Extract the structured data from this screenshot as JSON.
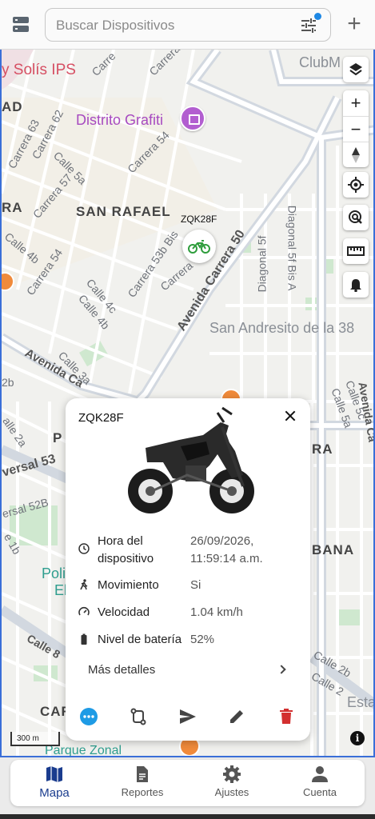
{
  "search": {
    "placeholder": "Buscar Dispositivos"
  },
  "icons": {
    "menu": "server-icon",
    "filter": "tune-icon",
    "add": "plus-icon",
    "accent": "#1e88e5"
  },
  "map": {
    "labels": {
      "ips": "y Solís IPS",
      "clubmed": "ClubM",
      "distrito": "Distrito Grafiti",
      "san_rafael": "SAN RAFAEL",
      "san_andresito": "San Andresito de la 38",
      "avenida_carrera_50": "Avenida Carrera 50",
      "carrera_63": "Carrera 63",
      "carrera_62": "Carrera 62",
      "carrera_57": "Carrera 57",
      "carrera_54": "Carrera 54",
      "carrera_54b": "Carrera 54",
      "carrera_53b": "Carrera 53b Bis",
      "carrera_top": "Carrera",
      "carrera_top2": "Carre",
      "carrera_mid": "Carrera",
      "calle_5a": "Calle 5a",
      "calle_4b": "Calle 4b",
      "calle_4b2": "Calle 4b",
      "calle_4c": "Calle 4c",
      "calle_3a": "Calle 3a",
      "calle_5a_right": "Calle 5a",
      "calle_5c": "Calle 5c",
      "calle_2b": "Calle 2b",
      "calle_2": "Calle 2",
      "calle_8": "Calle 8",
      "calle_2a": "alle 2a",
      "diagonal_5f_bis_a": "Diagonal 5f Bis A",
      "diagonal_5f": "Diagonal 5f",
      "avenida_ca": "Avenida Ca",
      "avenida_right": "Avenida Ca",
      "versal_53": "versal 53",
      "versal_52b": "ersal 52B",
      "ad": "AD",
      "ra": "RA",
      "ra_right": "RA",
      "p": "P",
      "bana": "BANA",
      "poli": "Poli",
      "el": "El",
      "car": "CAR",
      "esta": "Esta",
      "parque_zonal": "Parque Zonal",
      "b2": "2b",
      "b1": "e 1b"
    },
    "vehicle_label": "ZQK28F",
    "controls": [
      "layers-icon",
      "zoom-in-icon",
      "zoom-out-icon",
      "compass-icon",
      "my-location-icon",
      "search-location-icon",
      "ruler-icon",
      "bell-icon"
    ],
    "zoom_in": "+",
    "zoom_out": "−",
    "scale": "300 m",
    "attribution": "i"
  },
  "card": {
    "title": "ZQK28F",
    "rows": [
      {
        "icon": "clock-icon",
        "key": "Hora del dispositivo",
        "value": "26/09/2026, 11:59:14 a.m."
      },
      {
        "icon": "walk-icon",
        "key": "Movimiento",
        "value": "Si"
      },
      {
        "icon": "speed-icon",
        "key": "Velocidad",
        "value": "1.04 km/h"
      },
      {
        "icon": "battery-icon",
        "key": "Nivel de batería",
        "value": "52%"
      }
    ],
    "more": "Más detalles",
    "actions": [
      "more-icon",
      "route-icon",
      "send-icon",
      "edit-icon",
      "delete-icon"
    ],
    "colors": {
      "more": "#1e9be5",
      "delete": "#d32f2f"
    }
  },
  "nav": {
    "items": [
      {
        "label": "Mapa",
        "icon": "map-icon",
        "active": true
      },
      {
        "label": "Reportes",
        "icon": "document-icon"
      },
      {
        "label": "Ajustes",
        "icon": "gear-icon"
      },
      {
        "label": "Cuenta",
        "icon": "account-icon"
      }
    ],
    "active_color": "#1a3c8e"
  }
}
